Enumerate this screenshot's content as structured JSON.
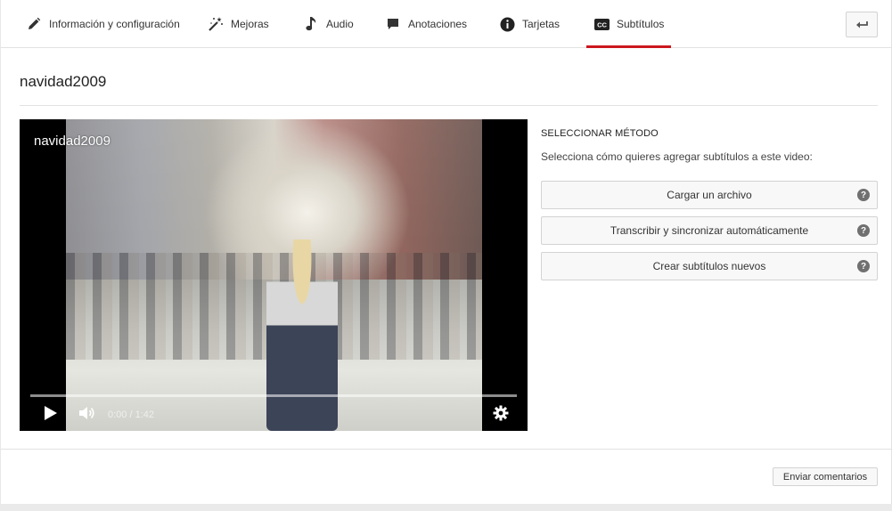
{
  "tabs": [
    {
      "label": "Información y configuración",
      "icon": "pencil-icon"
    },
    {
      "label": "Mejoras",
      "icon": "magic-wand-icon"
    },
    {
      "label": "Audio",
      "icon": "music-note-icon"
    },
    {
      "label": "Anotaciones",
      "icon": "speech-bubble-icon"
    },
    {
      "label": "Tarjetas",
      "icon": "info-icon"
    },
    {
      "label": "Subtítulos",
      "icon": "cc-icon",
      "active": true
    }
  ],
  "back_button_icon": "return-arrow-icon",
  "video_title": "navidad2009",
  "player": {
    "overlay_title": "navidad2009",
    "time": "0:00 / 1:42",
    "progress": 0
  },
  "method": {
    "heading": "SELECCIONAR MÉTODO",
    "description": "Selecciona cómo quieres agregar subtítulos a este video:",
    "options": [
      {
        "label": "Cargar un archivo",
        "help": "?"
      },
      {
        "label": "Transcribir y sincronizar automáticamente",
        "help": "?"
      },
      {
        "label": "Crear subtítulos nuevos",
        "help": "?"
      }
    ]
  },
  "feedback_label": "Enviar comentarios",
  "colors": {
    "active_tab_underline": "#cc181e"
  }
}
